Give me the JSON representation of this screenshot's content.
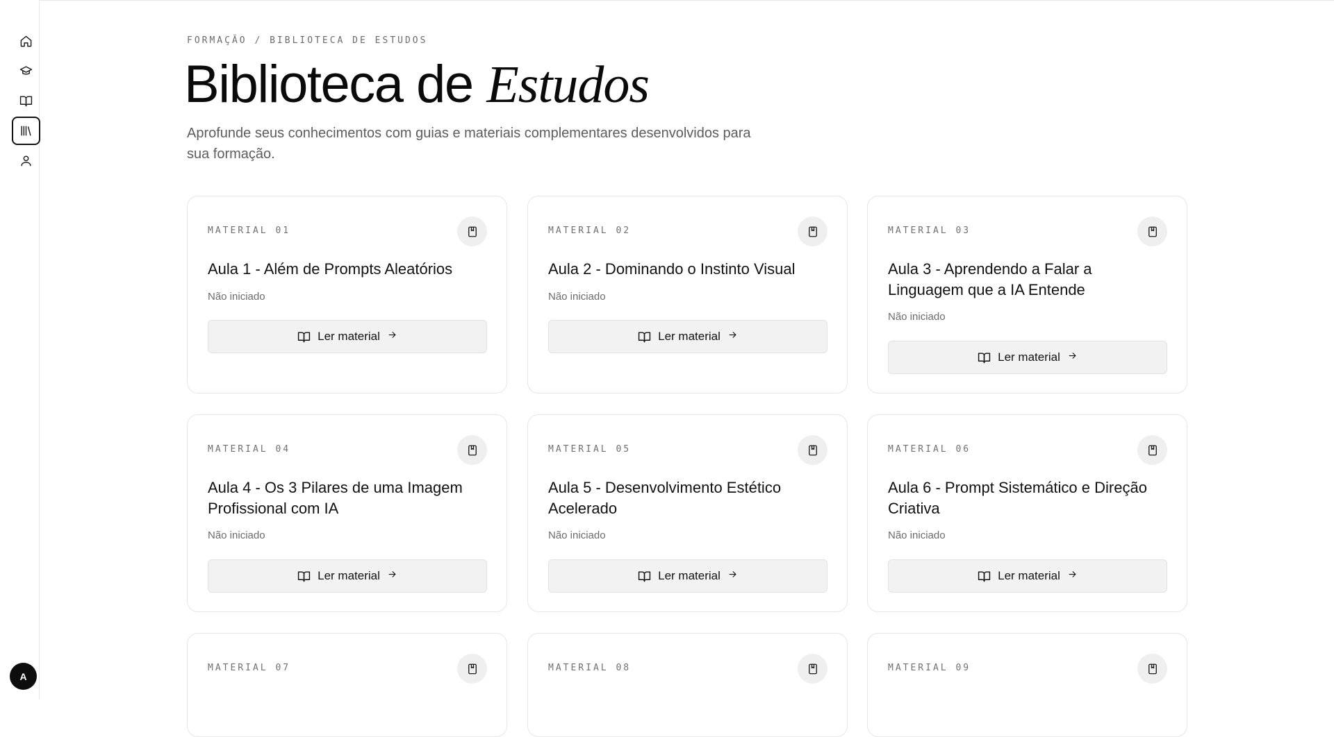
{
  "sidebar": {
    "items": [
      {
        "name": "home",
        "icon": "home-icon",
        "active": false
      },
      {
        "name": "courses",
        "icon": "graduation-cap-icon",
        "active": false
      },
      {
        "name": "lessons",
        "icon": "book-open-icon",
        "active": false
      },
      {
        "name": "library",
        "icon": "library-icon",
        "active": true
      },
      {
        "name": "profile",
        "icon": "user-icon",
        "active": false
      }
    ],
    "avatar_initial": "A"
  },
  "header": {
    "breadcrumb": "FORMAÇÃO / BIBLIOTECA DE ESTUDOS",
    "title_plain": "Biblioteca de",
    "title_accent": "Estudos",
    "subtitle": "Aprofunde seus conhecimentos com guias e materiais complementares desenvolvidos para sua formação."
  },
  "materials": [
    {
      "label": "MATERIAL 01",
      "title": "Aula 1 - Além de Prompts Aleatórios",
      "status": "Não iniciado",
      "button": "Ler material"
    },
    {
      "label": "MATERIAL 02",
      "title": "Aula 2 - Dominando o Instinto Visual",
      "status": "Não iniciado",
      "button": "Ler material"
    },
    {
      "label": "MATERIAL 03",
      "title": "Aula 3 - Aprendendo a Falar a Linguagem que a IA Entende",
      "status": "Não iniciado",
      "button": "Ler material"
    },
    {
      "label": "MATERIAL 04",
      "title": "Aula 4 - Os 3 Pilares de uma Imagem Profissional com IA",
      "status": "Não iniciado",
      "button": "Ler material"
    },
    {
      "label": "MATERIAL 05",
      "title": "Aula 5 - Desenvolvimento Estético Acelerado",
      "status": "Não iniciado",
      "button": "Ler material"
    },
    {
      "label": "MATERIAL 06",
      "title": "Aula 6 - Prompt Sistemático e Direção Criativa",
      "status": "Não iniciado",
      "button": "Ler material"
    },
    {
      "label": "MATERIAL 07"
    },
    {
      "label": "MATERIAL 08"
    },
    {
      "label": "MATERIAL 09"
    }
  ]
}
